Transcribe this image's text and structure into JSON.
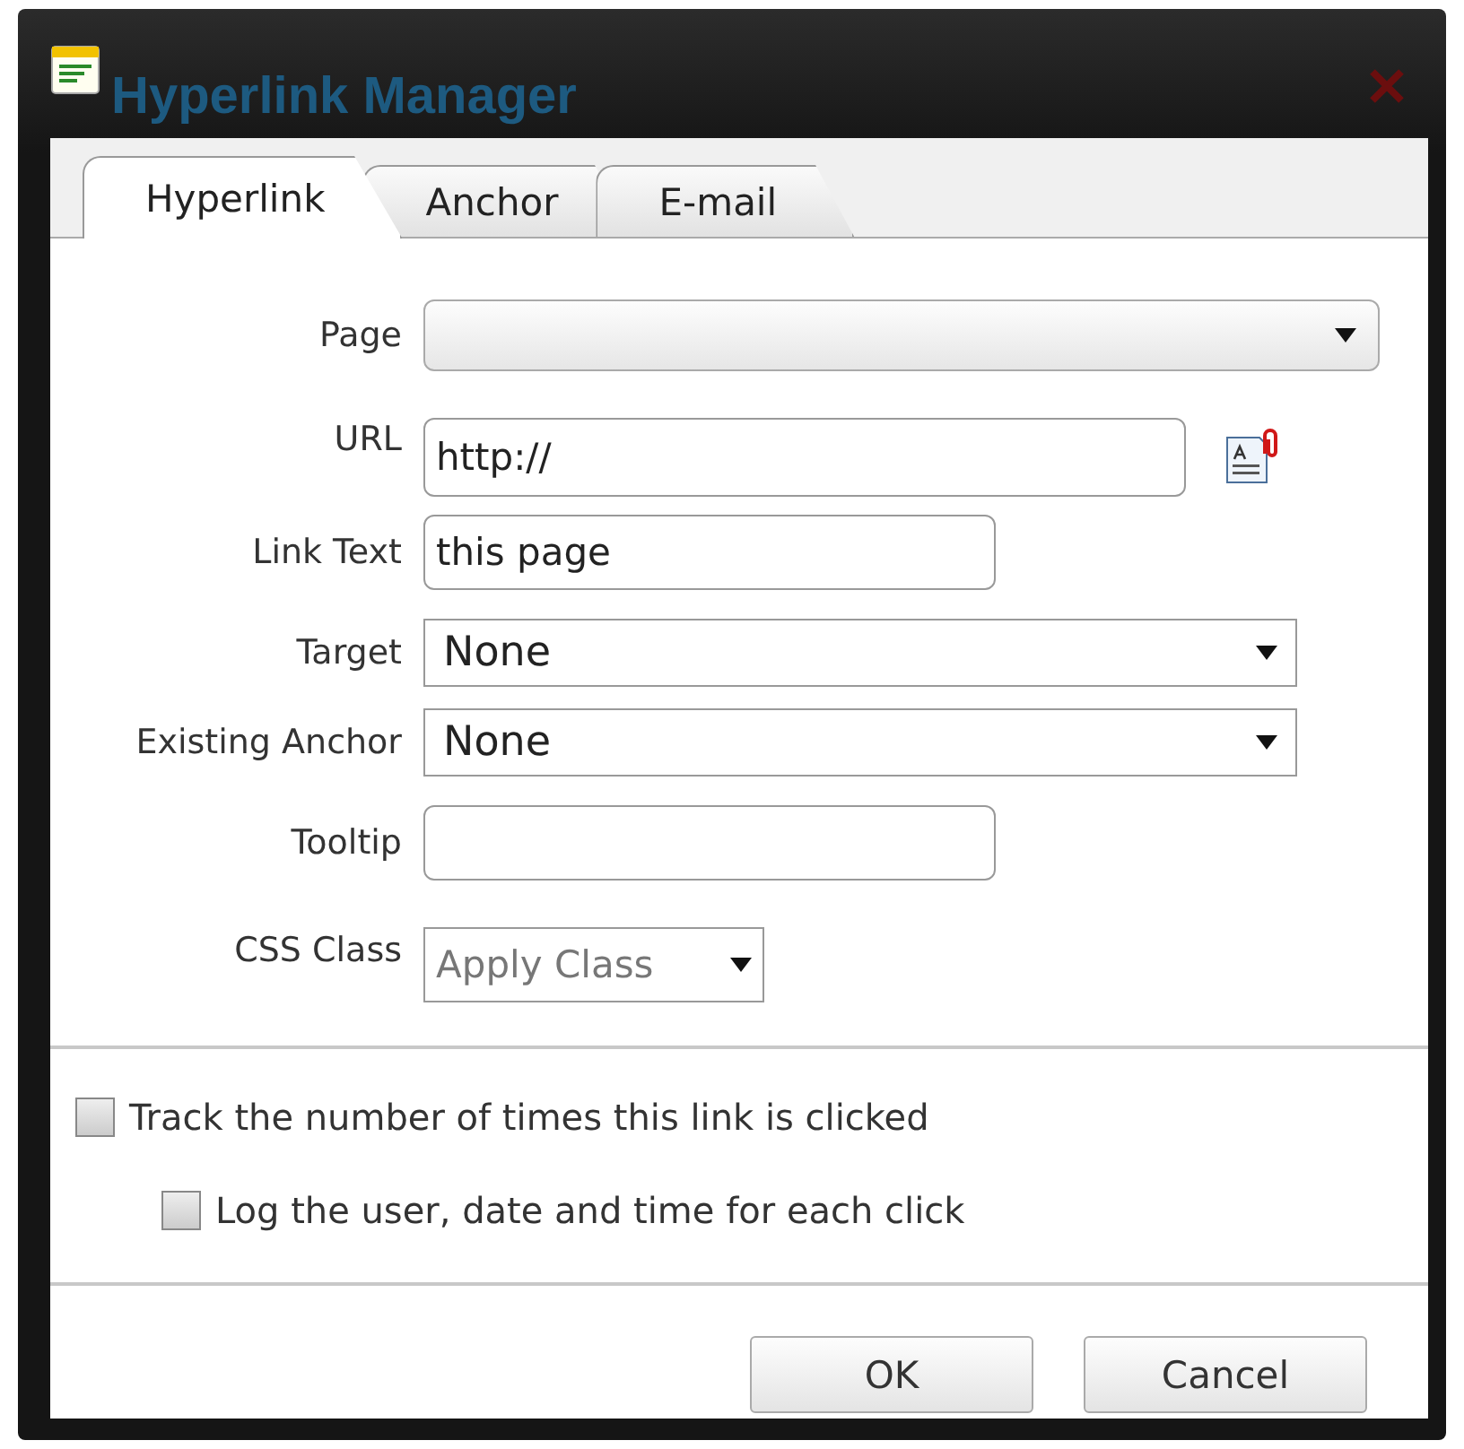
{
  "window": {
    "title": "Hyperlink Manager"
  },
  "tabs": [
    {
      "label": "Hyperlink",
      "selected": true
    },
    {
      "label": "Anchor",
      "selected": false
    },
    {
      "label": "E-mail",
      "selected": false
    }
  ],
  "fields": [
    {
      "label": "Page",
      "kind": "combo"
    },
    {
      "label": "URL",
      "kind": "url",
      "value": "http://"
    },
    {
      "label": "Link Text",
      "kind": "text",
      "value": "this page"
    },
    {
      "label": "Target",
      "kind": "select",
      "value": "None"
    },
    {
      "label": "Existing Anchor",
      "kind": "select",
      "value": "None"
    },
    {
      "label": "Tooltip",
      "kind": "text"
    },
    {
      "label": "CSS Class",
      "kind": "class",
      "value": "Apply Class"
    }
  ],
  "options": [
    {
      "label": "Track the number of times this link is clicked",
      "checked": false,
      "indented": false
    },
    {
      "label": "Log the user, date and time for each click",
      "checked": false,
      "indented": true
    }
  ],
  "buttons": [
    "OK",
    "Cancel"
  ]
}
